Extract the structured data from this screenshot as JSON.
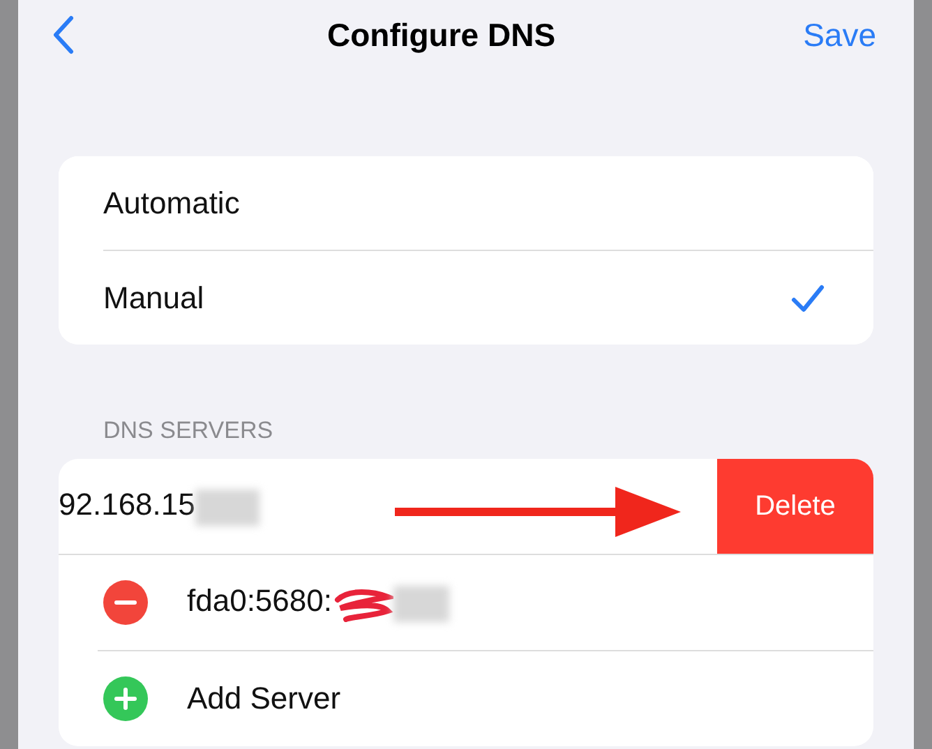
{
  "nav": {
    "title": "Configure DNS",
    "save": "Save"
  },
  "modes": [
    {
      "label": "Automatic",
      "selected": false
    },
    {
      "label": "Manual",
      "selected": true
    }
  ],
  "dns_servers": {
    "header": "DNS SERVERS",
    "servers": [
      {
        "address": "92.168.15",
        "swiped": true,
        "action": "Delete"
      },
      {
        "address": "fda0:5680:",
        "swiped": false
      }
    ],
    "add": "Add Server"
  }
}
